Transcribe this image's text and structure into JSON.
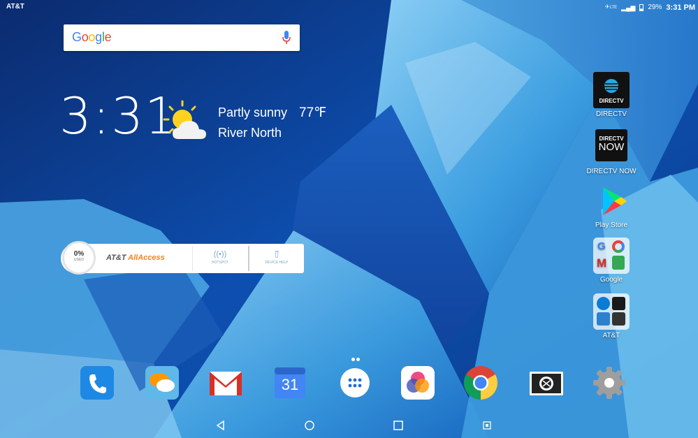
{
  "status_bar": {
    "carrier": "AT&T",
    "lte": "LTE",
    "battery": "29%",
    "time": "3:31 PM"
  },
  "search": {
    "logo": "Google",
    "icon": "mic-icon"
  },
  "clock": {
    "time": "3:31"
  },
  "weather": {
    "condition": "Partly sunny",
    "temperature": "77℉",
    "location": "River North",
    "icon": "partly-sunny-icon"
  },
  "att_widget": {
    "usage_percent": "0%",
    "usage_label": "USED",
    "brand_prefix": "AT&T ",
    "brand_accent": "AllAccess",
    "hotspot_label": "HOTSPOT",
    "device_help_label": "DEVICE HELP"
  },
  "side_apps": [
    {
      "label": "DIRECTV",
      "icon": "directv-icon"
    },
    {
      "label": "DIRECTV NOW",
      "icon": "directv-now-icon",
      "tile_top": "DIRECTV",
      "tile_bottom": "NOW"
    },
    {
      "label": "Play Store",
      "icon": "play-store-icon"
    },
    {
      "label": "Google",
      "icon": "google-folder-icon"
    },
    {
      "label": "AT&T",
      "icon": "att-folder-icon"
    }
  ],
  "dock": [
    {
      "name": "phone-icon"
    },
    {
      "name": "messages-icon"
    },
    {
      "name": "gmail-icon"
    },
    {
      "name": "calendar-icon",
      "text": "31"
    },
    {
      "name": "app-drawer-icon"
    },
    {
      "name": "photos-icon"
    },
    {
      "name": "chrome-icon"
    },
    {
      "name": "camera-icon"
    },
    {
      "name": "settings-icon"
    }
  ],
  "nav": [
    "back-icon",
    "home-icon",
    "recents-icon",
    "screenshot-icon"
  ],
  "colors": {
    "att_orange": "#f58220",
    "phone_blue": "#1e88e5",
    "gmail_red": "#d93025"
  }
}
